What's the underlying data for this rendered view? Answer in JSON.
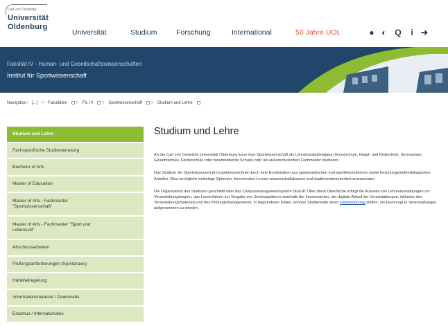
{
  "logo": {
    "small": "Carl von Ossietzky",
    "line1": "Universität",
    "line2": "Oldenburg"
  },
  "mainnav": [
    {
      "label": "Universität"
    },
    {
      "label": "Studium"
    },
    {
      "label": "Forschung"
    },
    {
      "label": "International"
    },
    {
      "label": "50 Jahre UOL"
    }
  ],
  "icons": [
    {
      "name": "globe-icon",
      "glyph": "●"
    },
    {
      "name": "contrast-icon",
      "glyph": "◐"
    },
    {
      "name": "search-icon",
      "glyph": "Q"
    },
    {
      "name": "info-icon",
      "glyph": "i"
    },
    {
      "name": "login-icon",
      "glyph": "➔"
    }
  ],
  "banner": {
    "faculty": "Fakultät IV - Human- und Gesellschaftswissenschaften",
    "institute": "Institut für Sportwissenschaft"
  },
  "breadcrumb": {
    "label": "Navigation:",
    "items": [
      "[...]",
      "Fakultäten",
      "Fk. IV",
      "Sportwissenschaft",
      "Studium und Lehre"
    ]
  },
  "sidebar": {
    "items": [
      {
        "label": "Studium und Lehre",
        "active": true
      },
      {
        "label": "Fachspezifische Studienberatung"
      },
      {
        "label": "Bachelor of Arts"
      },
      {
        "label": "Master of Education"
      },
      {
        "label": "Master of Arts - Fachmaster\n\"Sportwissenschaft\""
      },
      {
        "label": "Master of Arts - Fachmaster \"Sport und\nLebensstil\""
      },
      {
        "label": "Abschlussarbeiten"
      },
      {
        "label": "Prüfungsanforderungen (Sportpraxis)"
      },
      {
        "label": "Härtefallregelung"
      },
      {
        "label": "Informationsmaterial / Downloads"
      },
      {
        "label": "Erasmus / Internationales"
      }
    ]
  },
  "content": {
    "title": "Studium und Lehre",
    "para1": "An der Carl von Ossietzky Universität Oldenburg kann man Sportwissenschaft als Lehramtsstudiengang (Grundschule, Haupt- und Realschule, Gymnasium, Gesamtschule, Förderschule oder berufsbildende Schule) oder als außerschulischen Fachmaster studieren.",
    "para2": "Das Studium der Sportwissenschaft ist gekennzeichnet durch eine Kombination aus sportpraktischen und sporttheoretischen sowie forschungsmethodologischen Anteilen. Dies ermöglicht vielseitige Optionen, forschendes Lernen wissenschaftsbasiert und studierendenorientiert anzuwenden.",
    "para3_before": "Die Organisation des Studiums geschieht über das Campusmanagementsystem Stud.IP. Über diese Oberfläche erfolgt die Auswahl von Lehrveranstaltungen vor Veranstaltungsbeginn, das Losverfahren zur Vergabe von Seminarplätzen innerhalb der Interessierten, der digitale Ablauf der Veranstaltungen, inklusive des Veranstaltungsmaterials und des Prüfungsmanagements. In begründeten Fällen, können Studierende einen ",
    "para3_link": "Härtefallantrag",
    "para3_after": " stellen, um bevorzugt in Veranstaltungen aufgenommen zu werden."
  }
}
